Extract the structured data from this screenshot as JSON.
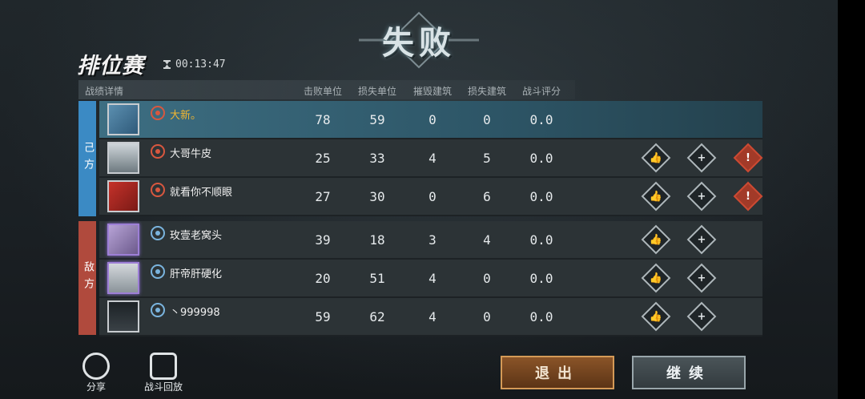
{
  "result_title": "失败",
  "mode_title": "排位赛",
  "timer": "00:13:47",
  "table": {
    "section_label": "战绩详情",
    "columns": [
      "击败单位",
      "损失单位",
      "摧毁建筑",
      "损失建筑",
      "战斗评分"
    ]
  },
  "sides": {
    "own": "己方",
    "enemy": "敌方"
  },
  "players": [
    {
      "name": "大新。",
      "team": "own",
      "is_me": true,
      "stats": [
        "78",
        "59",
        "0",
        "0",
        "0.0"
      ]
    },
    {
      "name": "大哥牛皮",
      "team": "own",
      "is_me": false,
      "stats": [
        "25",
        "33",
        "4",
        "5",
        "0.0"
      ]
    },
    {
      "name": "就看你不顺眼",
      "team": "own",
      "is_me": false,
      "stats": [
        "27",
        "30",
        "0",
        "6",
        "0.0"
      ]
    },
    {
      "name": "玫壹老窝头",
      "team": "enemy",
      "is_me": false,
      "stats": [
        "39",
        "18",
        "3",
        "4",
        "0.0"
      ]
    },
    {
      "name": "肝帝肝硬化",
      "team": "enemy",
      "is_me": false,
      "stats": [
        "20",
        "51",
        "4",
        "0",
        "0.0"
      ]
    },
    {
      "name": "丶999998",
      "team": "enemy",
      "is_me": false,
      "stats": [
        "59",
        "62",
        "4",
        "0",
        "0.0"
      ]
    }
  ],
  "bottom": {
    "share": "分享",
    "replay": "战斗回放"
  },
  "buttons": {
    "exit": "退出",
    "continue": "继续"
  },
  "colors": {
    "own_side": "#3b8ac4",
    "enemy_side": "#b04a3d",
    "my_name": "#f2b630",
    "report": "#a23a28"
  }
}
